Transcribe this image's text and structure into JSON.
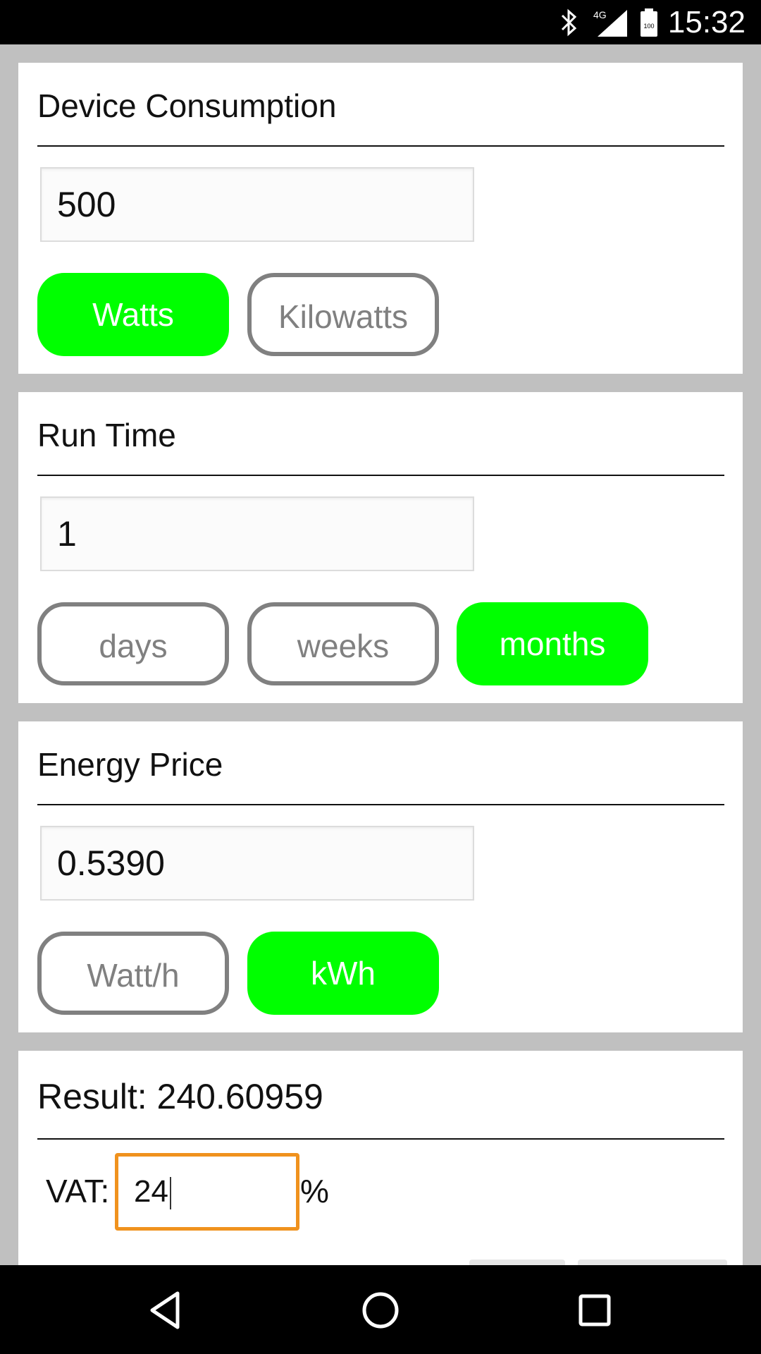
{
  "status_bar": {
    "time": "15:32",
    "network": "4G",
    "battery_text": "100",
    "icons": [
      "bluetooth-icon",
      "signal-icon",
      "battery-icon"
    ]
  },
  "device_consumption": {
    "title": "Device Consumption",
    "value": "500",
    "units": [
      "Watts",
      "Kilowatts"
    ],
    "selected_unit": "Watts"
  },
  "run_time": {
    "title": "Run Time",
    "value": "1",
    "units": [
      "days",
      "weeks",
      "months"
    ],
    "selected_unit": "months"
  },
  "energy_price": {
    "title": "Energy Price",
    "value": "0.5390",
    "units": [
      "Watt/h",
      "kWh"
    ],
    "selected_unit": "kWh"
  },
  "result": {
    "title": "Result: 240.60959",
    "vat_label": "VAT:",
    "vat_value": "24",
    "vat_unit": "%"
  },
  "nav_bar": {
    "icons": [
      "back-icon",
      "home-icon",
      "recents-icon"
    ]
  },
  "colors": {
    "selected": "#00ff00",
    "unselected_border": "#808080",
    "focus_border": "#f0921e",
    "page_background": "#c0c0c0"
  }
}
